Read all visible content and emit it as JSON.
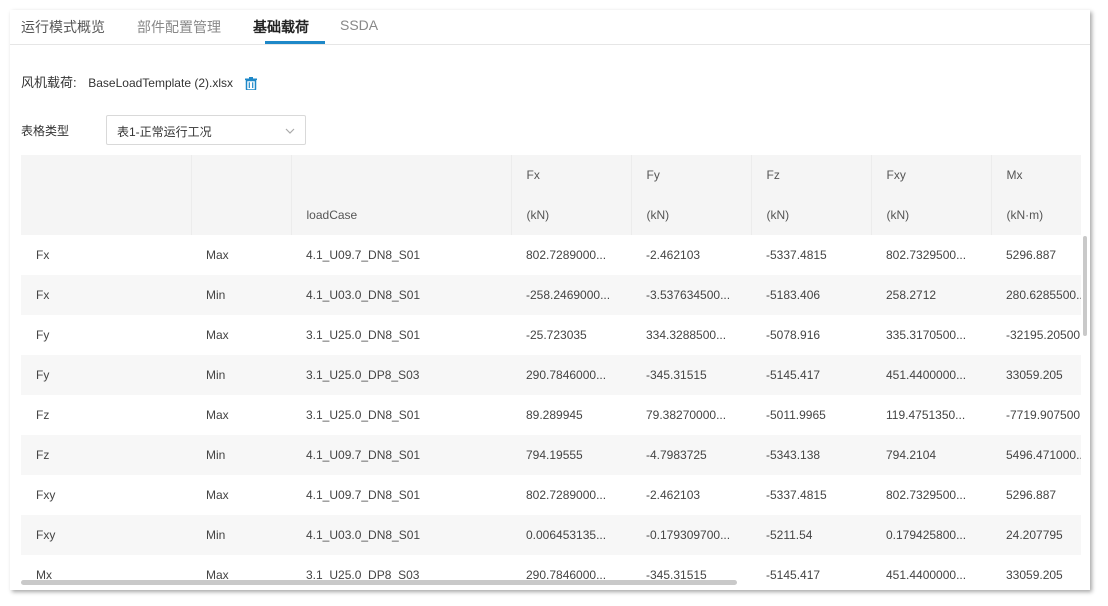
{
  "tabs": [
    {
      "label": "运行模式概览"
    },
    {
      "label": "部件配置管理"
    },
    {
      "label": "基础载荷"
    },
    {
      "label": "SSDA"
    }
  ],
  "active_tab": "基础载荷",
  "file": {
    "label": "风机载荷:",
    "name": "BaseLoadTemplate (2).xlsx",
    "delete_icon": "trash-icon"
  },
  "table_type": {
    "label": "表格类型",
    "selected": "表1-正常运行工况"
  },
  "columns": [
    {
      "name": "",
      "unit": ""
    },
    {
      "name": "",
      "unit": ""
    },
    {
      "name": "",
      "unit": "loadCase"
    },
    {
      "name": "Fx",
      "unit": "(kN)"
    },
    {
      "name": "Fy",
      "unit": "(kN)"
    },
    {
      "name": "Fz",
      "unit": "(kN)"
    },
    {
      "name": "Fxy",
      "unit": "(kN)"
    },
    {
      "name": "Mx",
      "unit": "(kN·m)"
    }
  ],
  "rows": [
    [
      "Fx",
      "Max",
      "4.1_U09.7_DN8_S01",
      "802.7289000...",
      "-2.462103",
      "-5337.4815",
      "802.7329500...",
      "5296.887"
    ],
    [
      "Fx",
      "Min",
      "4.1_U03.0_DN8_S01",
      "-258.2469000...",
      "-3.537634500...",
      "-5183.406",
      "258.2712",
      "280.6285500..."
    ],
    [
      "Fy",
      "Max",
      "3.1_U25.0_DN8_S01",
      "-25.723035",
      "334.3288500...",
      "-5078.916",
      "335.3170500...",
      "-32195.20500..."
    ],
    [
      "Fy",
      "Min",
      "3.1_U25.0_DP8_S03",
      "290.7846000...",
      "-345.31515",
      "-5145.417",
      "451.4400000...",
      "33059.205"
    ],
    [
      "Fz",
      "Max",
      "3.1_U25.0_DN8_S01",
      "89.289945",
      "79.38270000...",
      "-5011.9965",
      "119.4751350...",
      "-7719.907500..."
    ],
    [
      "Fz",
      "Min",
      "4.1_U09.7_DN8_S01",
      "794.19555",
      "-4.7983725",
      "-5343.138",
      "794.2104",
      "5496.471000..."
    ],
    [
      "Fxy",
      "Max",
      "4.1_U09.7_DN8_S01",
      "802.7289000...",
      "-2.462103",
      "-5337.4815",
      "802.7329500...",
      "5296.887"
    ],
    [
      "Fxy",
      "Min",
      "4.1_U03.0_DN8_S01",
      "0.006453135...",
      "-0.179309700...",
      "-5211.54",
      "0.179425800...",
      "24.207795"
    ],
    [
      "Mx",
      "Max",
      "3.1_U25.0_DP8_S03",
      "290.7846000...",
      "-345.31515",
      "-5145.417",
      "451.4400000...",
      "33059.205"
    ]
  ]
}
